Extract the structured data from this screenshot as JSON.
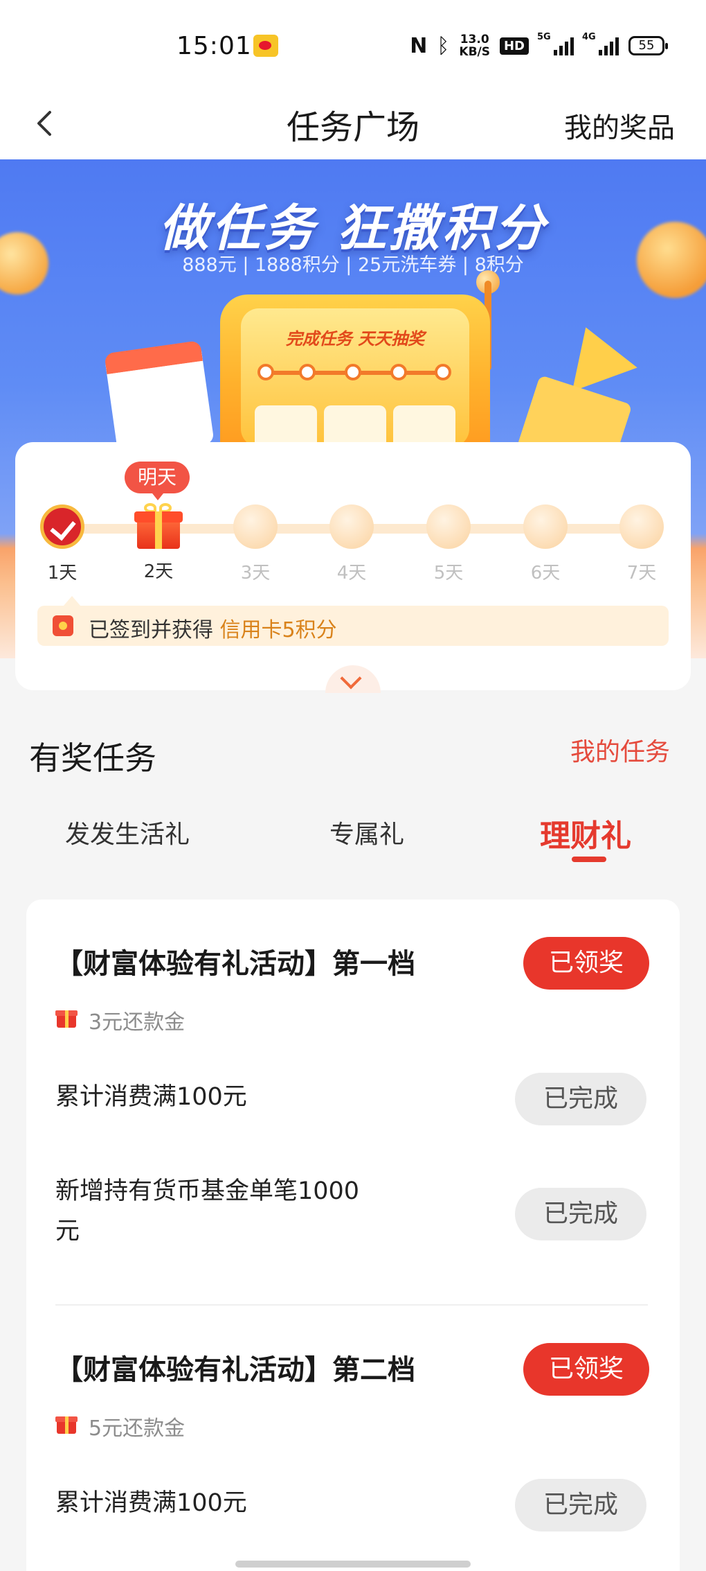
{
  "status_bar": {
    "time": "15:01",
    "speed_value": "13.0",
    "speed_unit": "KB/S",
    "hd": "HD",
    "signal_1": "5G",
    "signal_2": "4G",
    "battery": "55"
  },
  "nav": {
    "title": "任务广场",
    "right_link": "我的奖品"
  },
  "banner": {
    "title": "做任务 狂撒积分",
    "subtitle": "888元 | 1888积分 | 25元洗车券 | 8积分",
    "machine_label": "完成任务 天天抽奖"
  },
  "signin": {
    "tomorrow_badge": "明天",
    "days": [
      {
        "label": "1天",
        "state": "checked"
      },
      {
        "label": "2天",
        "state": "gift"
      },
      {
        "label": "3天",
        "state": "pending"
      },
      {
        "label": "4天",
        "state": "pending"
      },
      {
        "label": "5天",
        "state": "pending"
      },
      {
        "label": "6天",
        "state": "pending"
      },
      {
        "label": "7天",
        "state": "pending"
      }
    ],
    "reward_prefix": "已签到并获得",
    "reward_highlight": "信用卡5积分"
  },
  "tasks": {
    "section_title": "有奖任务",
    "my_tasks_link": "我的任务",
    "tabs": [
      "发发生活礼",
      "专属礼",
      "理财礼"
    ],
    "active_tab": "理财礼",
    "groups": [
      {
        "title": "【财富体验有礼活动】第一档",
        "status": "已领奖",
        "gift": "3元还款金",
        "items": [
          {
            "text": "累计消费满100元",
            "status": "已完成"
          },
          {
            "text_line1": "新增持有货币基金单笔1000",
            "text_line2": "元",
            "status": "已完成"
          }
        ]
      },
      {
        "title": "【财富体验有礼活动】第二档",
        "status": "已领奖",
        "gift": "5元还款金",
        "items": [
          {
            "text": "累计消费满100元",
            "status": "已完成"
          }
        ]
      }
    ]
  },
  "colors": {
    "accent_red": "#e8362b",
    "highlight_orange": "#d9821a",
    "banner_blue": "#4f7af2"
  }
}
